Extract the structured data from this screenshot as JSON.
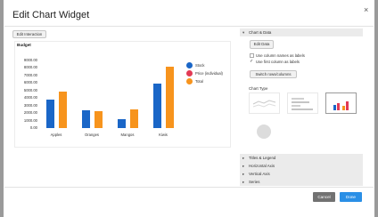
{
  "dialog": {
    "title": "Edit Chart Widget",
    "close_glyph": "×",
    "edit_interaction_label": "Edit Interaction"
  },
  "chart_data": {
    "type": "bar",
    "title": "Budget",
    "categories": [
      "Apples",
      "Oranges",
      "Mangos",
      "Kiwis"
    ],
    "series": [
      {
        "name": "Stock",
        "color": "#1a66c7",
        "values": [
          3800,
          2400,
          1200,
          5900
        ]
      },
      {
        "name": "Price (individual)",
        "color": "#e23a55",
        "values": [
          0,
          0,
          0,
          0
        ]
      },
      {
        "name": "Total",
        "color": "#f7941d",
        "values": [
          4800,
          2200,
          2500,
          8200
        ]
      }
    ],
    "y_ticks": [
      "9000.00",
      "8000.00",
      "7000.00",
      "6000.00",
      "5000.00",
      "4000.00",
      "3000.00",
      "2000.00",
      "1000.00",
      "0.00"
    ],
    "ylim": [
      0,
      9000
    ],
    "legend_position": "right",
    "grid": false
  },
  "panel": {
    "sections_open": {
      "label": "Chart & Data",
      "caret": "▾"
    },
    "edit_data_label": "Edit Data",
    "options": [
      {
        "label": "Use column names as labels",
        "checked": false
      },
      {
        "label": "Use first column as labels",
        "checked": true
      }
    ],
    "check_glyph": "✓",
    "switch_label": "Switch rows/columns",
    "chart_type_label": "Chart Type",
    "chart_types": [
      "line",
      "horizontal-bar",
      "column",
      "pie"
    ],
    "selected_chart_type": "column",
    "collapsed_sections": [
      {
        "label": "Titles & Legend",
        "caret": "▸"
      },
      {
        "label": "Horizontal Axis",
        "caret": "▸"
      },
      {
        "label": "Vertical Axis",
        "caret": "▸"
      },
      {
        "label": "Series",
        "caret": "▸"
      }
    ]
  },
  "footer": {
    "cancel_label": "Cancel",
    "done_label": "Done"
  }
}
